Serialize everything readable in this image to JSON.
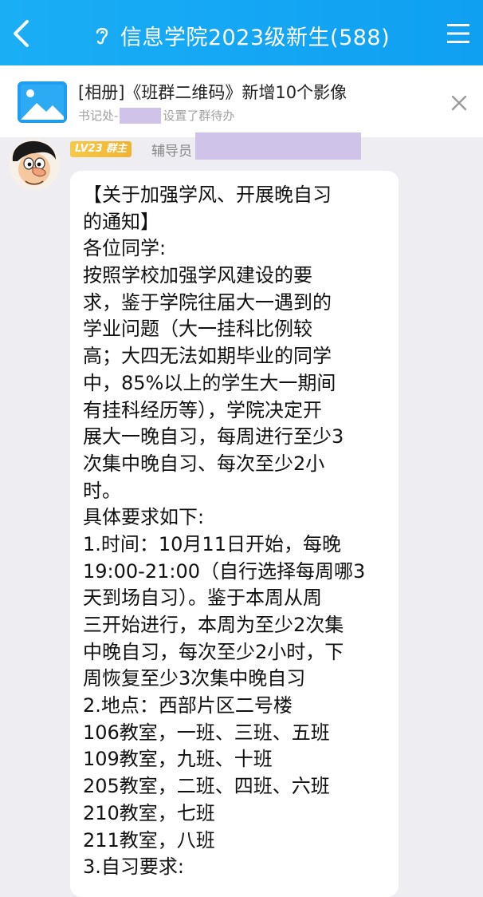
{
  "header": {
    "back_icon": "back-chevron-icon",
    "title": "信息学院2023级新生(588)",
    "ear_icon": "ear-icon",
    "menu_icon": "hamburger-menu-icon"
  },
  "notice": {
    "icon": "album-picture-icon",
    "title": "[相册]《班群二维码》新增10个影像",
    "sub_prefix": "书记处-",
    "sub_suffix": "设置了群待办",
    "close_icon": "close-icon"
  },
  "message": {
    "badge": "LV23 群主",
    "sender_prefix": "辅导员",
    "lines": [
      "【关于加强学风、开展晚自习",
      "的通知】",
      "各位同学:",
      "按照学校加强学风建设的要",
      "求，鉴于学院往届大一遇到的",
      "学业问题（大一挂科比例较",
      "高；大四无法如期毕业的同学",
      "中，85%以上的学生大一期间",
      "有挂科经历等），学院决定开",
      "展大一晚自习，每周进行至少3",
      "次集中晚自习、每次至少2小",
      "时。",
      "具体要求如下:",
      "1.时间：10月11日开始，每晚",
      "19:00-21:00（自行选择每周哪3",
      "天到场自习）。鉴于本周从周",
      "三开始进行，本周为至少2次集",
      "中晚自习，每次至少2小时，下",
      "周恢复至少3次集中晚自习",
      "2.地点：西部片区二号楼",
      "106教室，一班、三班、五班",
      "109教室，九班、十班",
      "205教室，二班、四班、六班",
      "210教室，七班",
      "211教室，八班",
      "3.自习要求:"
    ]
  },
  "colors": {
    "header_bg": "#12a6f4",
    "badge_bg": "#f2b92f",
    "redaction": "#cfc3ea"
  }
}
